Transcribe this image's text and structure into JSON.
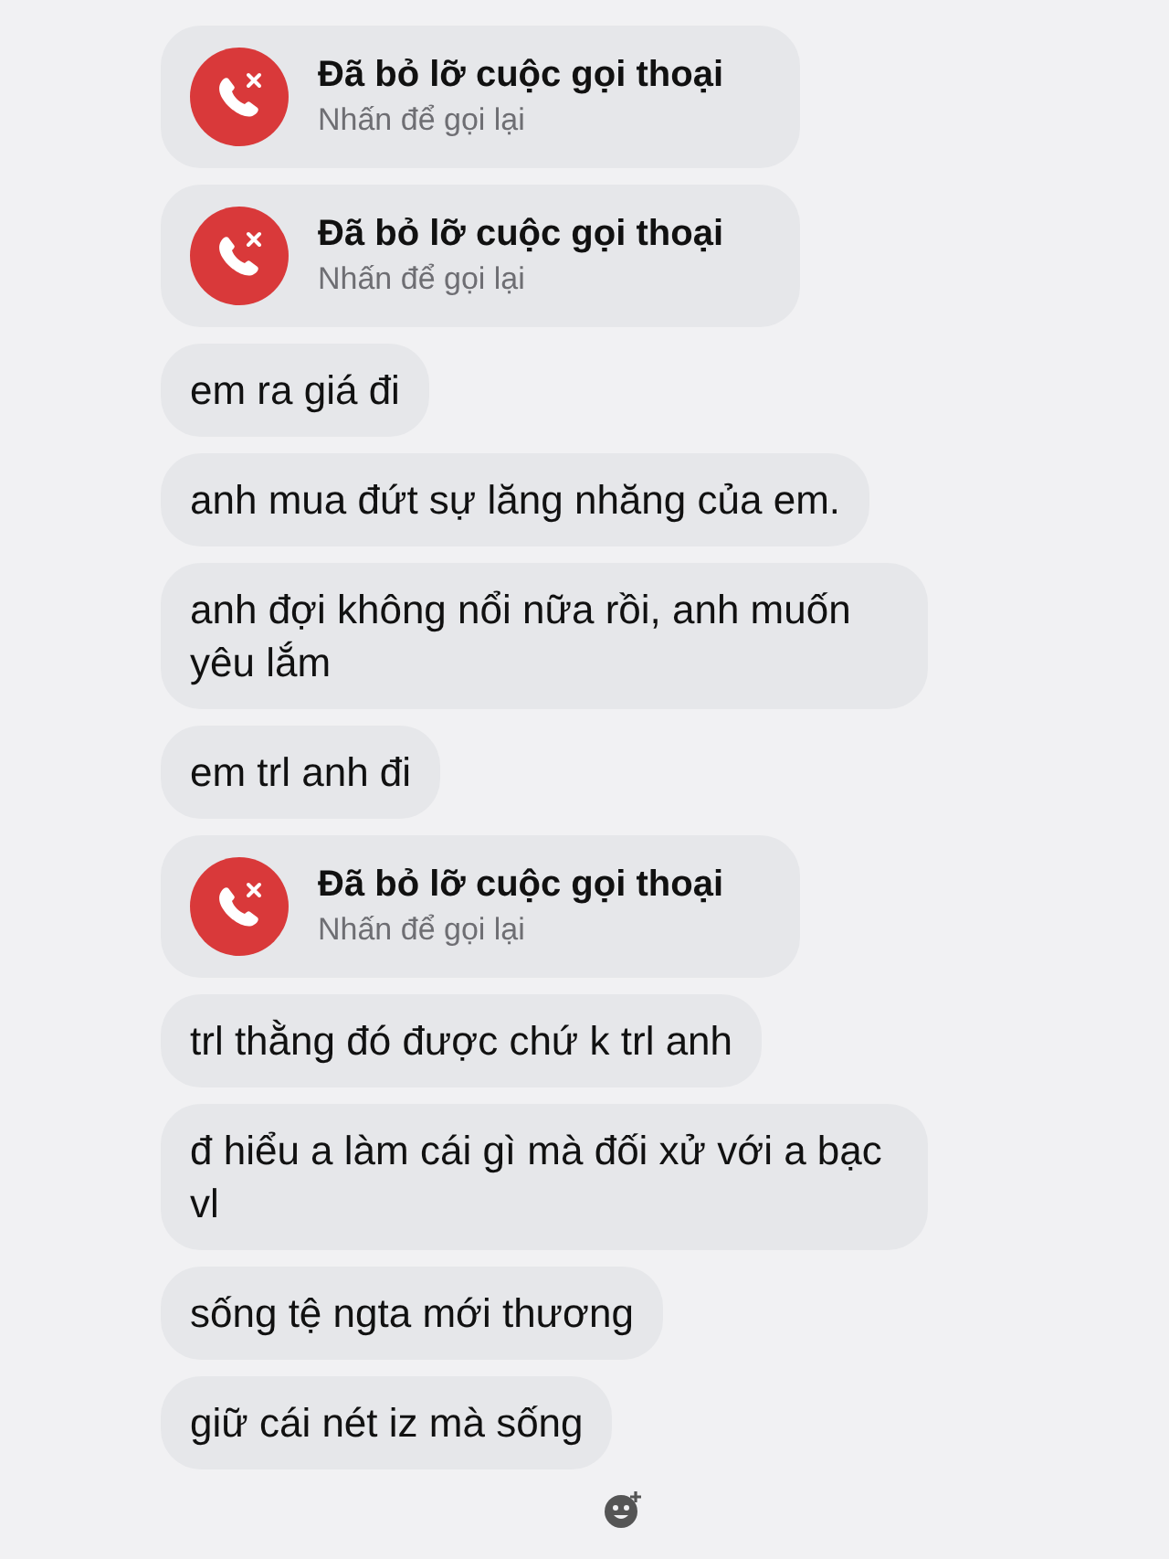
{
  "messages": [
    {
      "kind": "call",
      "title": "Đã bỏ lỡ cuộc gọi thoại",
      "subtitle": "Nhấn để gọi lại"
    },
    {
      "kind": "call",
      "title": "Đã bỏ lỡ cuộc gọi thoại",
      "subtitle": "Nhấn để gọi lại"
    },
    {
      "kind": "text",
      "text": "em ra giá đi"
    },
    {
      "kind": "text",
      "text": "anh mua đứt sự lăng nhăng của em."
    },
    {
      "kind": "text",
      "text": "anh đợi không nổi nữa rồi, anh muốn yêu lắm"
    },
    {
      "kind": "text",
      "text": "em trl anh đi"
    },
    {
      "kind": "call",
      "title": "Đã bỏ lỡ cuộc gọi thoại",
      "subtitle": "Nhấn để gọi lại"
    },
    {
      "kind": "text",
      "text": "trl thằng đó được chứ k trl anh"
    },
    {
      "kind": "text",
      "text": "đ hiểu a làm cái gì mà đối xử với a bạc vl"
    },
    {
      "kind": "text",
      "text": "sống tệ ngta mới thương"
    },
    {
      "kind": "text",
      "text": "giữ cái nét iz mà sống"
    }
  ]
}
